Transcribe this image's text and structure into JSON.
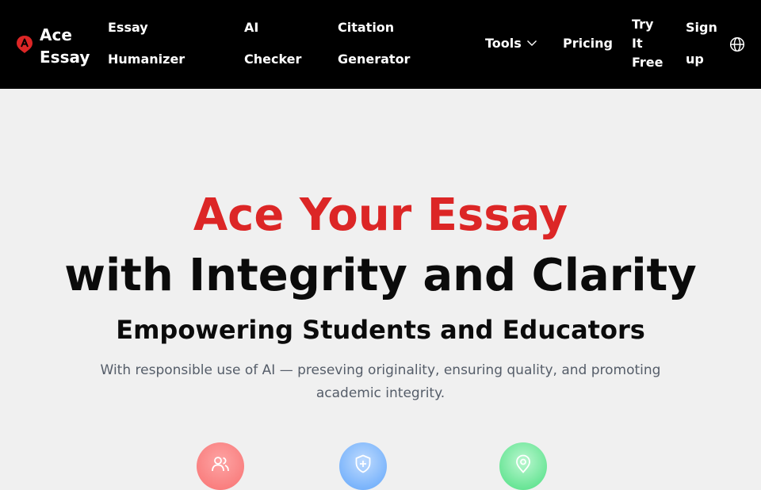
{
  "brand": {
    "line1": "Ace",
    "line2": "Essay",
    "icon": "ace-logo-icon",
    "color": "#dc2626"
  },
  "nav": {
    "essay_humanizer": {
      "line1": "Essay",
      "line2": "Humanizer"
    },
    "ai_checker": {
      "line1": "AI",
      "line2": "Checker"
    },
    "citation_generator": {
      "line1": "Citation",
      "line2": "Generator"
    },
    "tools": "Tools",
    "pricing": "Pricing",
    "try_it_free": {
      "line1": "Try",
      "line2": "It",
      "line3": "Free"
    },
    "sign_up": {
      "line1": "Sign",
      "line2": "up"
    },
    "language_icon": "globe-icon"
  },
  "hero": {
    "title_red": "Ace Your Essay",
    "title_black": "with Integrity and Clarity",
    "subtitle": "Empowering Students and Educators",
    "description": "With responsible use of AI — preseving originality, ensuring quality, and promoting academic integrity."
  },
  "features": [
    {
      "icon": "users-icon",
      "color": "#f87171"
    },
    {
      "icon": "shield-plus-icon",
      "color": "#60a5fa"
    },
    {
      "icon": "map-pin-icon",
      "color": "#4ade80"
    }
  ]
}
